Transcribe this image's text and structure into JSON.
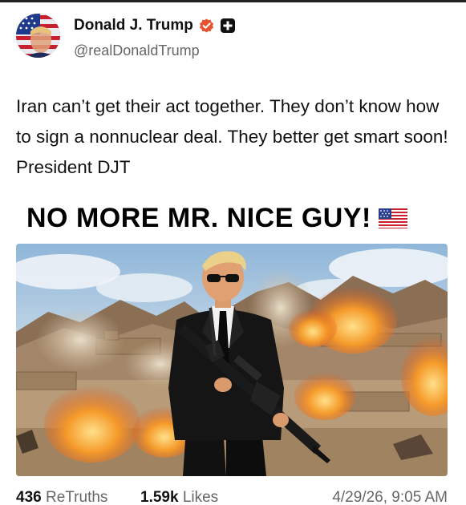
{
  "author": {
    "display_name": "Donald J. Trump",
    "handle": "@realDonaldTrump",
    "avatar_icon": "avatar-flag-portrait",
    "verified_icon": "verified-badge-icon",
    "plus_icon": "plus-badge-icon"
  },
  "post": {
    "text": "Iran can’t get their act together. They don’t know how to sign a nonnuclear deal. They better get smart soon! President DJT"
  },
  "image": {
    "headline": "NO MORE MR. NICE GUY!",
    "flag_icon": "us-flag-emoji"
  },
  "stats": {
    "retruths_count": "436",
    "retruths_label": "ReTruths",
    "likes_count": "1.59k",
    "likes_label": "Likes",
    "timestamp": "4/29/26, 9:05 AM"
  },
  "colors": {
    "verified": "#e8522f",
    "text": "#111111",
    "muted": "#666666",
    "sky": "#cfe0ee",
    "fire": "#f27a1e"
  }
}
